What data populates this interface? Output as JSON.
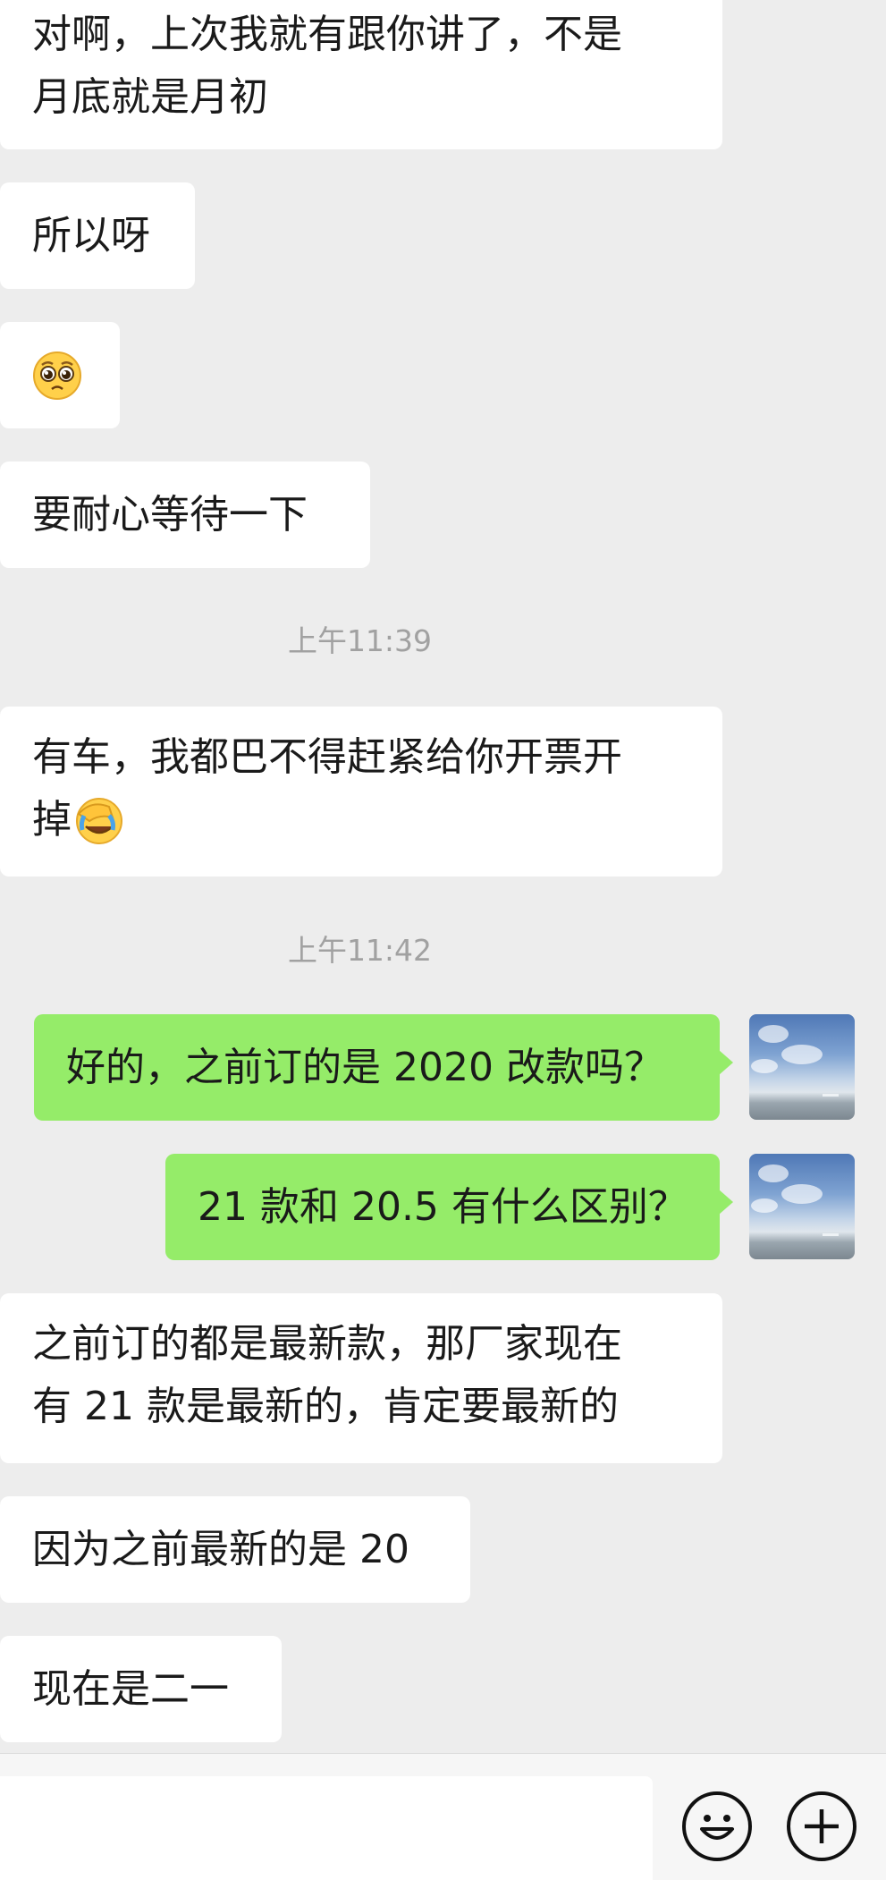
{
  "messages": [
    {
      "id": "m1",
      "side": "left",
      "lines": [
        "对啊，上次我就有跟你讲了，不是",
        "月底就是月初"
      ]
    },
    {
      "id": "m2",
      "side": "left",
      "text": "所以呀"
    },
    {
      "id": "m3",
      "side": "left",
      "emoji": "pleading-face-emoji"
    },
    {
      "id": "m4",
      "side": "left",
      "text": "要耐心等待一下"
    },
    {
      "id": "t1",
      "type": "timestamp",
      "text": "上午11:39"
    },
    {
      "id": "m5",
      "side": "left",
      "lines": [
        "有车，我都巴不得赶紧给你开票开",
        "掉"
      ],
      "trailing_emoji": "facepalm-emoji"
    },
    {
      "id": "t2",
      "type": "timestamp",
      "text": "上午11:42"
    },
    {
      "id": "m6",
      "side": "right",
      "text": "好的，之前订的是 2020 改款吗？"
    },
    {
      "id": "m7",
      "side": "right",
      "text": "21 款和 20.5 有什么区别？"
    },
    {
      "id": "m8",
      "side": "left",
      "lines": [
        "之前订的都是最新款，那厂家现在",
        "有 21 款是最新的，肯定要最新的"
      ]
    },
    {
      "id": "m9",
      "side": "left",
      "text": "因为之前最新的是 20"
    },
    {
      "id": "m10",
      "side": "left",
      "text": "现在是二一"
    }
  ],
  "colors": {
    "background": "#ededed",
    "incoming_bubble": "#ffffff",
    "outgoing_bubble": "#95ec69",
    "timestamp_text": "#a1a1a1"
  },
  "input_bar": {
    "icons": [
      "emoji-smile-icon",
      "plus-circle-icon"
    ]
  }
}
